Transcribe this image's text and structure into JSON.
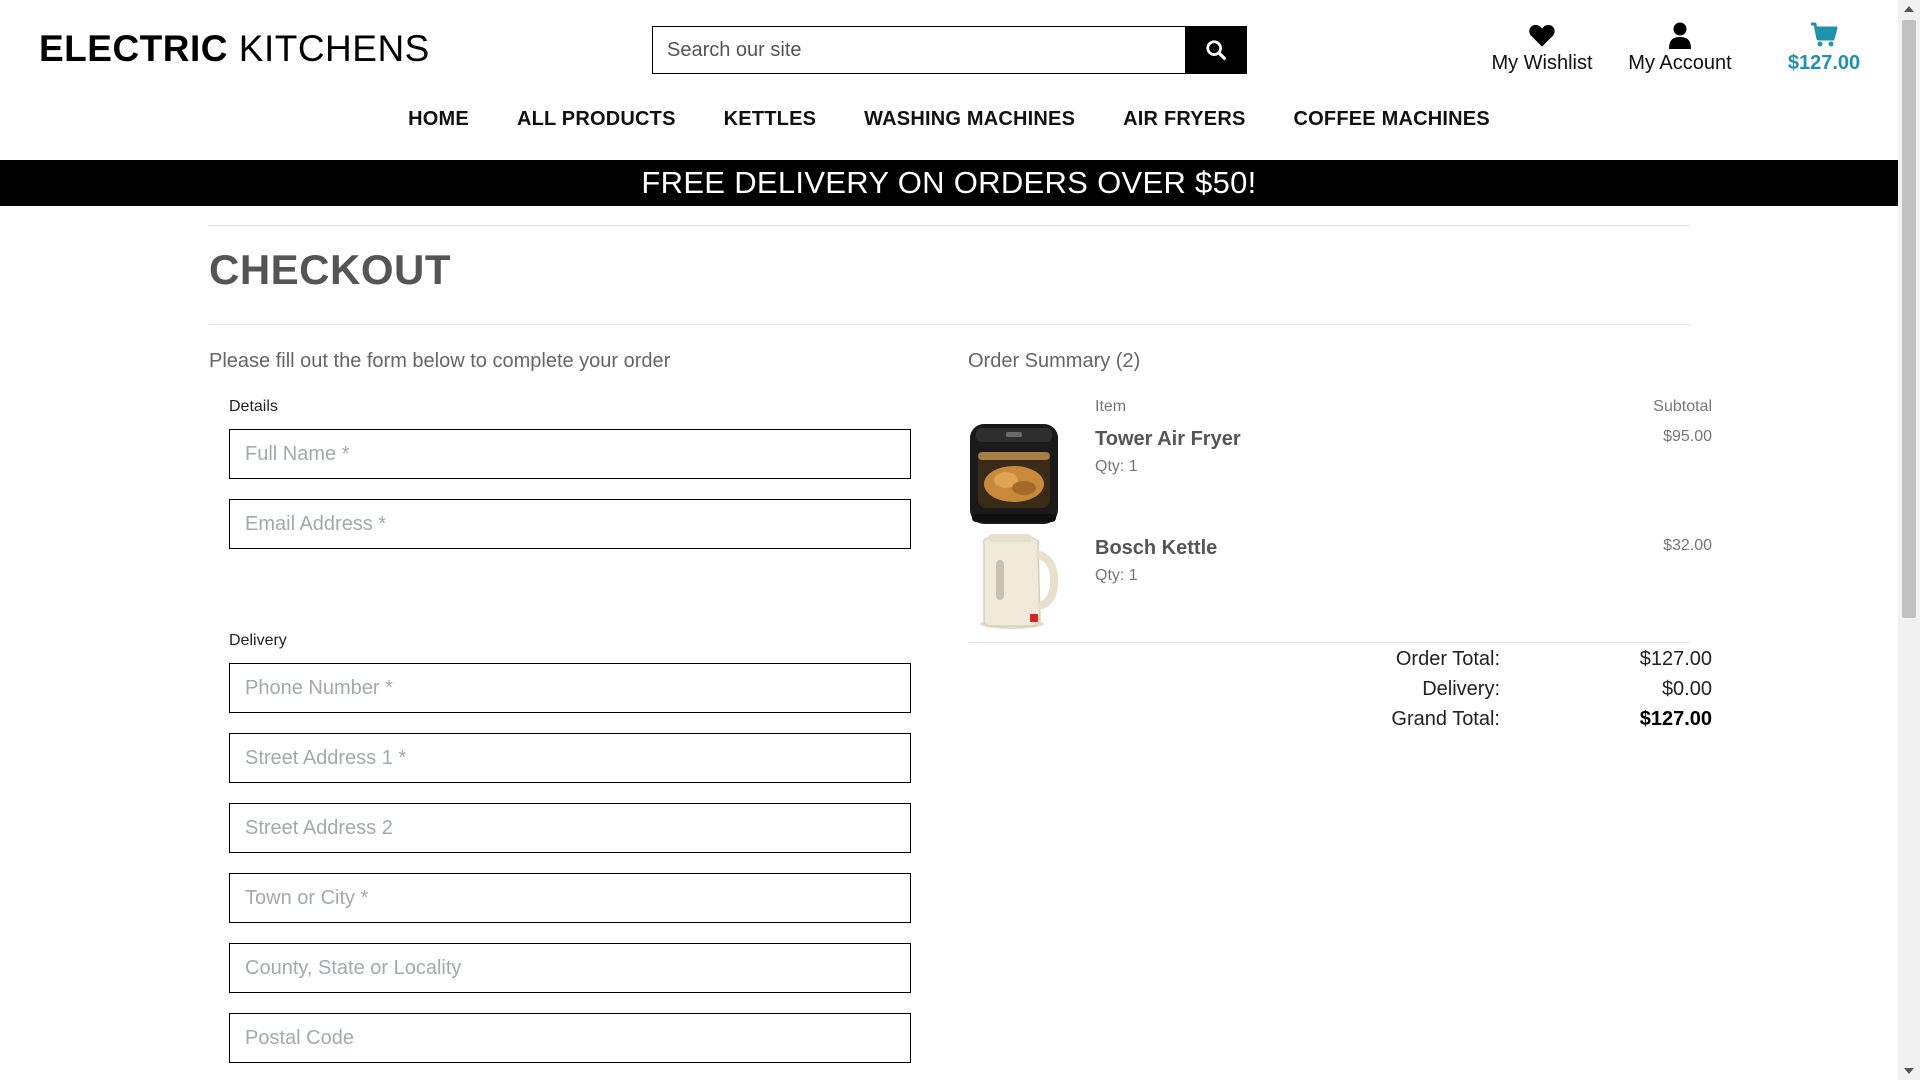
{
  "header": {
    "logo_bold": "ELECTRIC",
    "logo_light": " KITCHENS",
    "search_placeholder": "Search our site",
    "wishlist_label": "My Wishlist",
    "account_label": "My Account",
    "bag_total": "$127.00"
  },
  "nav": {
    "items": [
      "HOME",
      "ALL PRODUCTS",
      "KETTLES",
      "WASHING MACHINES",
      "AIR FRYERS",
      "COFFEE MACHINES"
    ]
  },
  "banner": {
    "text": "FREE DELIVERY ON ORDERS OVER $50!"
  },
  "checkout": {
    "title": "CHECKOUT",
    "lead": "Please fill out the form below to complete your order",
    "details_label": "Details",
    "delivery_label": "Delivery",
    "fields": {
      "full_name": "Full Name *",
      "email": "Email Address *",
      "phone": "Phone Number *",
      "street1": "Street Address 1 *",
      "street2": "Street Address 2",
      "town": "Town or City *",
      "county": "County, State or Locality",
      "postcode": "Postal Code"
    }
  },
  "summary": {
    "title": "Order Summary (2)",
    "col_item": "Item",
    "col_subtotal": "Subtotal",
    "items": [
      {
        "name": "Tower Air Fryer",
        "qty": "Qty: 1",
        "subtotal": "$95.00"
      },
      {
        "name": "Bosch Kettle",
        "qty": "Qty: 1",
        "subtotal": "$32.00"
      }
    ],
    "order_total_label": "Order Total:",
    "order_total": "$127.00",
    "delivery_label": "Delivery:",
    "delivery": "$0.00",
    "grand_total_label": "Grand Total:",
    "grand_total": "$127.00"
  },
  "colors": {
    "accent": "#1f93ae",
    "banner_bg": "#000000"
  }
}
